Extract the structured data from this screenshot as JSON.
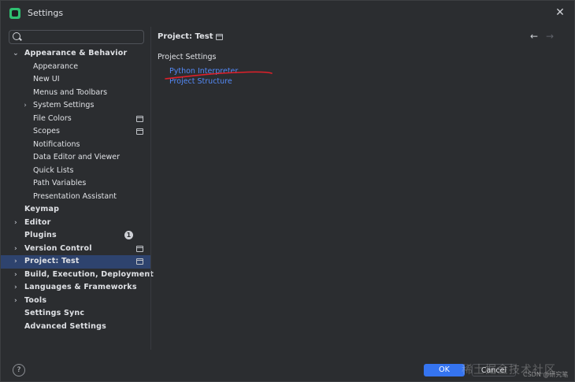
{
  "window": {
    "title": "Settings"
  },
  "search": {
    "placeholder": ""
  },
  "sidebar": {
    "items": [
      {
        "label": "Appearance & Behavior",
        "level": 1,
        "chevron": "chevron-down",
        "icon": null
      },
      {
        "label": "Appearance",
        "level": 2,
        "chevron": null,
        "icon": null
      },
      {
        "label": "New UI",
        "level": 2,
        "chevron": null,
        "icon": null
      },
      {
        "label": "Menus and Toolbars",
        "level": 2,
        "chevron": null,
        "icon": null
      },
      {
        "label": "System Settings",
        "level": 2,
        "chevron": "chevron-right",
        "icon": null
      },
      {
        "label": "File Colors",
        "level": 2,
        "chevron": null,
        "icon": "project-scope-icon"
      },
      {
        "label": "Scopes",
        "level": 2,
        "chevron": null,
        "icon": "project-scope-icon"
      },
      {
        "label": "Notifications",
        "level": 2,
        "chevron": null,
        "icon": null
      },
      {
        "label": "Data Editor and Viewer",
        "level": 2,
        "chevron": null,
        "icon": null
      },
      {
        "label": "Quick Lists",
        "level": 2,
        "chevron": null,
        "icon": null
      },
      {
        "label": "Path Variables",
        "level": 2,
        "chevron": null,
        "icon": null
      },
      {
        "label": "Presentation Assistant",
        "level": 2,
        "chevron": null,
        "icon": null
      },
      {
        "label": "Keymap",
        "level": 1,
        "chevron": null,
        "icon": null
      },
      {
        "label": "Editor",
        "level": 1,
        "chevron": "chevron-right",
        "icon": null
      },
      {
        "label": "Plugins",
        "level": 1,
        "chevron": null,
        "icon": null,
        "badge": "1"
      },
      {
        "label": "Version Control",
        "level": 1,
        "chevron": "chevron-right",
        "icon": "project-scope-icon"
      },
      {
        "label": "Project: Test",
        "level": 1,
        "chevron": "chevron-right",
        "icon": "project-scope-icon",
        "selected": true
      },
      {
        "label": "Build, Execution, Deployment",
        "level": 1,
        "chevron": "chevron-right",
        "icon": null
      },
      {
        "label": "Languages & Frameworks",
        "level": 1,
        "chevron": "chevron-right",
        "icon": null
      },
      {
        "label": "Tools",
        "level": 1,
        "chevron": "chevron-right",
        "icon": null
      },
      {
        "label": "Settings Sync",
        "level": 1,
        "chevron": null,
        "icon": null
      },
      {
        "label": "Advanced Settings",
        "level": 1,
        "chevron": null,
        "icon": null
      }
    ]
  },
  "main": {
    "breadcrumb": "Project: Test",
    "section_title": "Project Settings",
    "links": [
      "Python Interpreter",
      "Project Structure"
    ]
  },
  "footer": {
    "help_label": "?",
    "ok_label": "OK",
    "cancel_label": "Cancel",
    "watermark": "稀土掘金技术社区",
    "watermark_small": "CSDN @研究笔"
  },
  "colors": {
    "accent": "#3574f0",
    "link": "#548af7",
    "selection": "#2e436e",
    "annotation": "#e0202a"
  }
}
